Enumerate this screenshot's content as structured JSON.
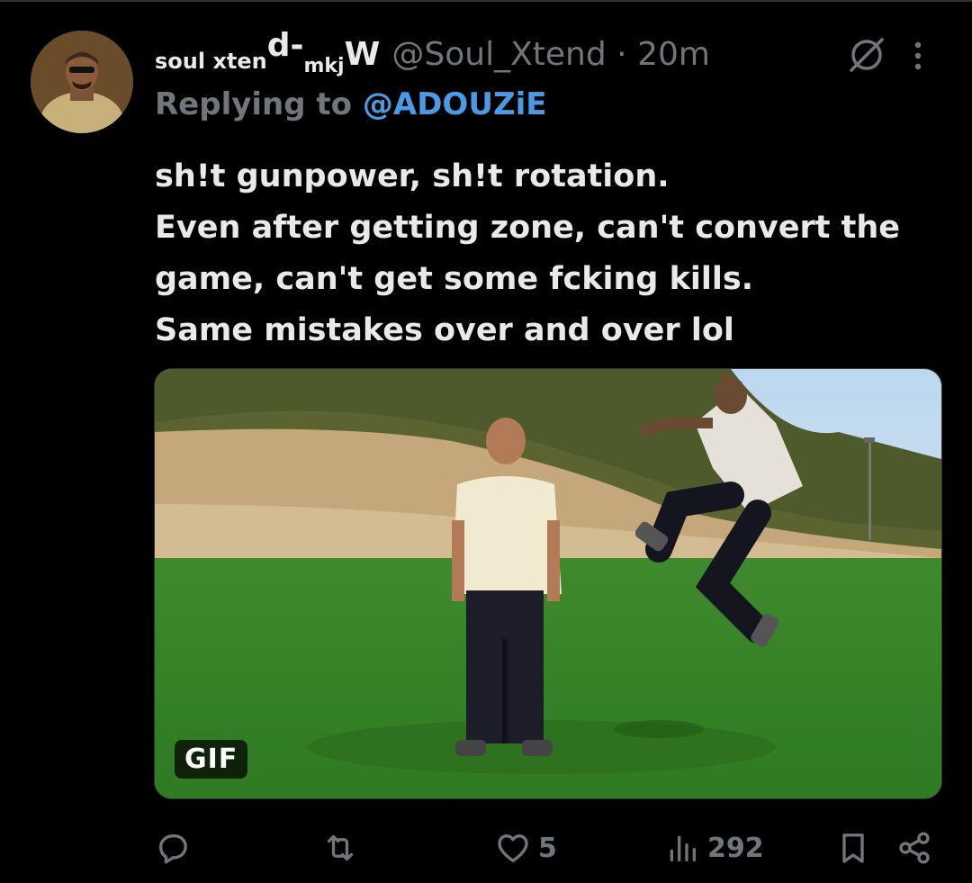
{
  "tweet": {
    "display_name": {
      "part1": "soul xten",
      "part2": "d-",
      "part3": "mkj",
      "part4": "W"
    },
    "handle": "@Soul_Xtend",
    "separator": "·",
    "time": "20m",
    "replying_prefix": "Replying to",
    "replying_to": "@ADOUZiE",
    "text_lines": [
      "sh!t gunpower, sh!t rotation.",
      "Even after getting zone, can't convert the",
      "game, can't get some fcking kills.",
      "Same mistakes over and over lol"
    ],
    "media_badge": "GIF"
  },
  "actions": {
    "reply": {
      "icon": "reply-icon"
    },
    "retweet": {
      "icon": "retweet-icon"
    },
    "like": {
      "icon": "heart-icon",
      "count": "5"
    },
    "views": {
      "icon": "views-icon",
      "count": "292"
    },
    "bookmark": {
      "icon": "bookmark-icon"
    },
    "share": {
      "icon": "share-icon"
    }
  },
  "colors": {
    "background": "#000000",
    "text": "#e7e9ea",
    "muted": "#71767b",
    "mention": "#4a9ae4"
  }
}
